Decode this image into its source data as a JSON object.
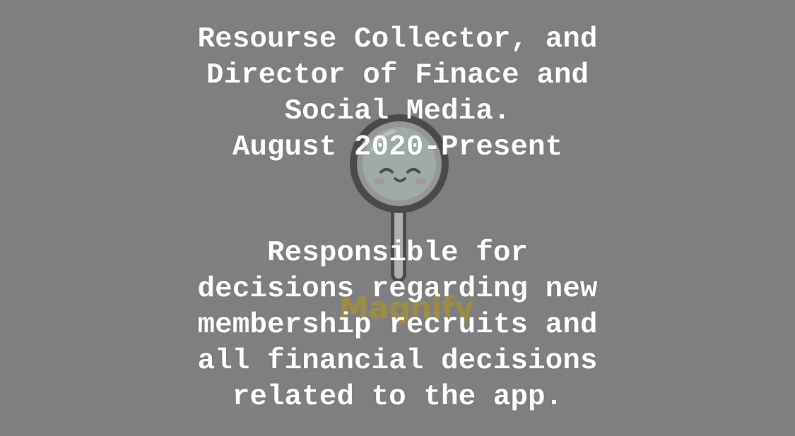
{
  "logo": {
    "icon": "magnifier-smiley-icon",
    "wordmark": "Magnify",
    "wordmark_color": "#b59a12"
  },
  "title": {
    "lines": [
      "Resourse Collector, and",
      "Director of Finace and",
      "Social Media.",
      "August 2020-Present"
    ]
  },
  "description": {
    "lines": [
      "Responsible for",
      "decisions regarding new",
      "membership recruits and",
      "all financial decisions",
      "related to the app."
    ]
  },
  "colors": {
    "background": "#7f7f7f",
    "text": "#ffffff"
  }
}
